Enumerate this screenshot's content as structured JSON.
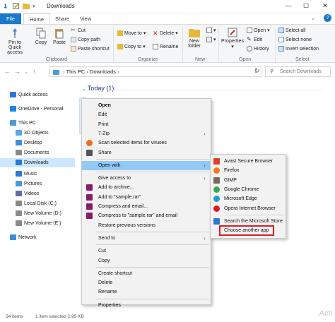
{
  "window": {
    "title": "Downloads",
    "icons": [
      "down-arrow-icon",
      "checkbox-icon",
      "folder-icon"
    ]
  },
  "tabs": [
    "File",
    "Home",
    "Share",
    "View"
  ],
  "ribbon": {
    "clipboard": {
      "group_label": "Clipboard",
      "pin": "Pin to Quick access",
      "copy": "Copy",
      "paste": "Paste",
      "cut": "Cut",
      "copy_path": "Copy path",
      "paste_shortcut": "Paste shortcut"
    },
    "organize": {
      "group_label": "Organize",
      "move_to": "Move to",
      "copy_to": "Copy to",
      "delete": "Delete",
      "rename": "Rename"
    },
    "new": {
      "group_label": "New",
      "new_folder": "New folder",
      "new_item": "New item"
    },
    "open": {
      "group_label": "Open",
      "properties": "Properties",
      "open": "Open",
      "edit": "Edit",
      "history": "History"
    },
    "select": {
      "group_label": "Select",
      "select_all": "Select all",
      "select_none": "Select none",
      "invert": "Invert selection"
    }
  },
  "address": {
    "path": [
      "This PC",
      "Downloads"
    ],
    "search_placeholder": "Search Downloads"
  },
  "nav": [
    {
      "label": "Quick access",
      "icon": "star-icon",
      "color": "#2b78d4"
    },
    {
      "label": "OneDrive - Personal",
      "icon": "cloud-icon",
      "color": "#1c86e2"
    },
    {
      "label": "This PC",
      "icon": "pc-icon",
      "color": "#4a9ad8"
    },
    {
      "label": "3D Objects",
      "icon": "cube-icon",
      "color": "#58a8e6"
    },
    {
      "label": "Desktop",
      "icon": "desktop-icon",
      "color": "#3b8fd9"
    },
    {
      "label": "Documents",
      "icon": "documents-icon",
      "color": "#8a8a8a"
    },
    {
      "label": "Downloads",
      "icon": "downloads-icon",
      "color": "#2b78d4"
    },
    {
      "label": "Music",
      "icon": "music-icon",
      "color": "#2b78d4"
    },
    {
      "label": "Pictures",
      "icon": "pictures-icon",
      "color": "#4a9ad8"
    },
    {
      "label": "Videos",
      "icon": "videos-icon",
      "color": "#5d6ca8"
    },
    {
      "label": "Local Disk (C:)",
      "icon": "disk-icon",
      "color": "#8a8a8a"
    },
    {
      "label": "New Volume (D:)",
      "icon": "disk-icon",
      "color": "#8a8a8a"
    },
    {
      "label": "New Volume (E:)",
      "icon": "disk-icon",
      "color": "#8a8a8a"
    },
    {
      "label": "Network",
      "icon": "network-icon",
      "color": "#3b8fd9"
    }
  ],
  "content": {
    "group_header": "Today (1)"
  },
  "context_menu": [
    {
      "label": "Open",
      "bold": true
    },
    {
      "label": "Edit"
    },
    {
      "label": "Print"
    },
    {
      "label": "7-Zip",
      "arrow": true
    },
    {
      "label": "Scan selected items for viruses",
      "icon": "avast-icon",
      "color": "#f26b1d"
    },
    {
      "label": "Share",
      "icon": "share-icon",
      "color": "#555555"
    },
    {
      "sep": true
    },
    {
      "label": "Open with",
      "arrow": true,
      "highlight": true
    },
    {
      "sep": true
    },
    {
      "label": "Give access to",
      "arrow": true
    },
    {
      "label": "Add to archive...",
      "icon": "winrar-icon",
      "color": "#8b1a6b"
    },
    {
      "label": "Add to \"sample.rar\"",
      "icon": "winrar-icon",
      "color": "#8b1a6b"
    },
    {
      "label": "Compress and email...",
      "icon": "winrar-icon",
      "color": "#8b1a6b"
    },
    {
      "label": "Compress to \"sample.rar\" and email",
      "icon": "winrar-icon",
      "color": "#8b1a6b"
    },
    {
      "label": "Restore previous versions"
    },
    {
      "sep": true
    },
    {
      "label": "Send to",
      "arrow": true
    },
    {
      "sep": true
    },
    {
      "label": "Cut"
    },
    {
      "label": "Copy"
    },
    {
      "sep": true
    },
    {
      "label": "Create shortcut"
    },
    {
      "label": "Delete"
    },
    {
      "label": "Rename"
    },
    {
      "sep": true
    },
    {
      "label": "Properties"
    }
  ],
  "submenu": [
    {
      "label": "Avast Secure Browser",
      "icon": "avast-browser-icon",
      "color": "#e0412c"
    },
    {
      "label": "Firefox",
      "icon": "firefox-icon",
      "color": "#ff7a18"
    },
    {
      "label": "GIMP",
      "icon": "gimp-icon",
      "color": "#7a6a55"
    },
    {
      "label": "Google Chrome",
      "icon": "chrome-icon",
      "color": "#34a853"
    },
    {
      "label": "Microsoft Edge",
      "icon": "edge-icon",
      "color": "#1f9bd6"
    },
    {
      "label": "Opera Internet Browser",
      "icon": "opera-icon",
      "color": "#e0171f"
    },
    {
      "sep": true
    },
    {
      "label": "Search the Microsoft Store",
      "icon": "store-icon",
      "color": "#2b78d4"
    },
    {
      "label": "Choose another app",
      "highlight_box": true
    }
  ],
  "status": {
    "items": "54 items",
    "selected": "1 item selected  2.95 KB"
  },
  "watermark": "Acti"
}
